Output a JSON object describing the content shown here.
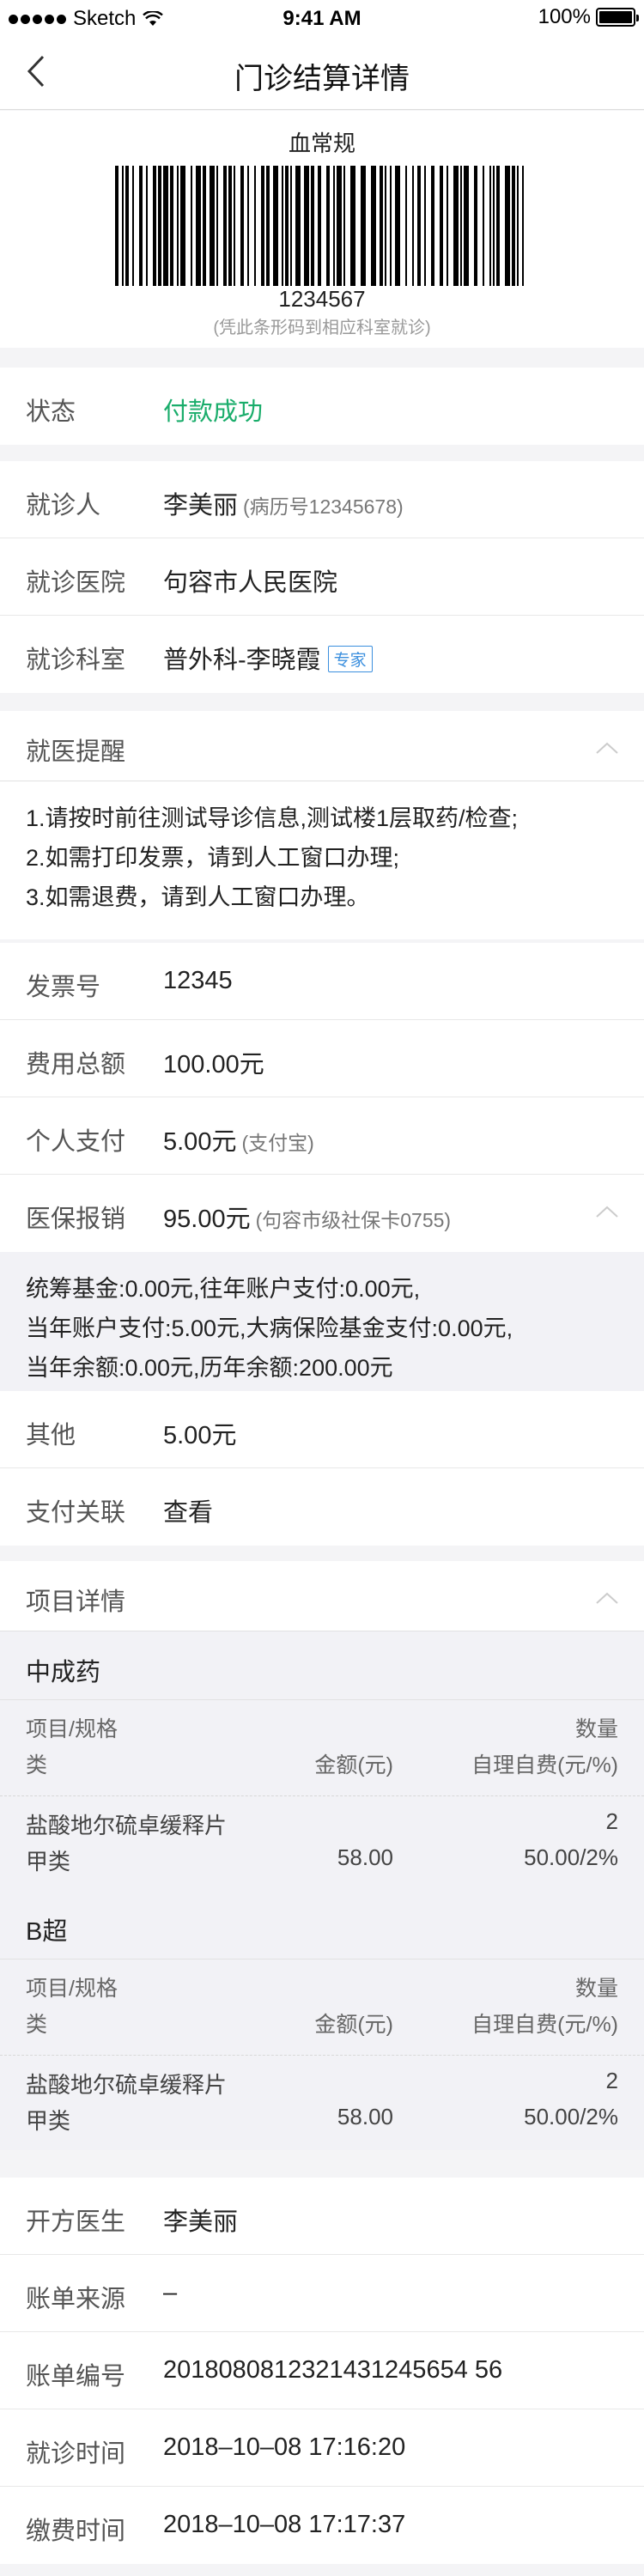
{
  "status_bar": {
    "carrier": "Sketch",
    "time": "9:41 AM",
    "battery": "100%"
  },
  "nav": {
    "title": "门诊结算详情"
  },
  "barcode": {
    "label": "血常规",
    "number": "1234567",
    "hint": "(凭此条形码到相应科室就诊)"
  },
  "status": {
    "label": "状态",
    "value": "付款成功",
    "color": "#1aad6b"
  },
  "patient": {
    "name_label": "就诊人",
    "name": "李美丽",
    "record": "(病历号12345678)",
    "hospital_label": "就诊医院",
    "hospital": "句容市人民医院",
    "dept_label": "就诊科室",
    "dept": "普外科-李晓霞",
    "dept_tag": "专家"
  },
  "reminder": {
    "title": "就医提醒",
    "lines": [
      "1.请按时前往测试导诊信息,测试楼1层取药/检查;",
      "2.如需打印发票，请到人工窗口办理;",
      "3.如需退费，请到人工窗口办理。"
    ]
  },
  "invoice": {
    "invoice_label": "发票号",
    "invoice": "12345",
    "total_label": "费用总额",
    "total": "100.00元",
    "personal_label": "个人支付",
    "personal": "5.00元",
    "personal_sub": "(支付宝)",
    "insurance_label": "医保报销",
    "insurance": "95.00元",
    "insurance_sub": "(句容市级社保卡0755)",
    "insurance_detail": [
      "统筹基金:0.00元,往年账户支付:0.00元,",
      "当年账户支付:5.00元,大病保险基金支付:0.00元,",
      "当年余额:0.00元,历年余额:200.00元"
    ],
    "other_label": "其他",
    "other": "5.00元",
    "link_label": "支付关联",
    "link": "查看"
  },
  "items": {
    "title": "项目详情",
    "groups": [
      {
        "name": "中成药",
        "h_item1": "项目/规格",
        "h_item2": "类",
        "h_amount": "金额(元)",
        "h_qty": "数量",
        "h_self": "自理自费(元/%)",
        "item_name": "盐酸地尔硫卓缓释片",
        "item_class": "甲类",
        "amount": "58.00",
        "qty": "2",
        "self": "50.00/2%"
      },
      {
        "name": "B超",
        "h_item1": "项目/规格",
        "h_item2": "类",
        "h_amount": "金额(元)",
        "h_qty": "数量",
        "h_self": "自理自费(元/%)",
        "item_name": "盐酸地尔硫卓缓释片",
        "item_class": "甲类",
        "amount": "58.00",
        "qty": "2",
        "self": "50.00/2%"
      }
    ]
  },
  "bill": {
    "doctor_label": "开方医生",
    "doctor": "李美丽",
    "source_label": "账单来源",
    "source": "–",
    "no_label": "账单编号",
    "no": "2018080812321431245654 56",
    "visit_label": "就诊时间",
    "visit": "2018–10–08 17:16:20",
    "pay_label": "缴费时间",
    "pay": "2018–10–08 17:17:37"
  }
}
